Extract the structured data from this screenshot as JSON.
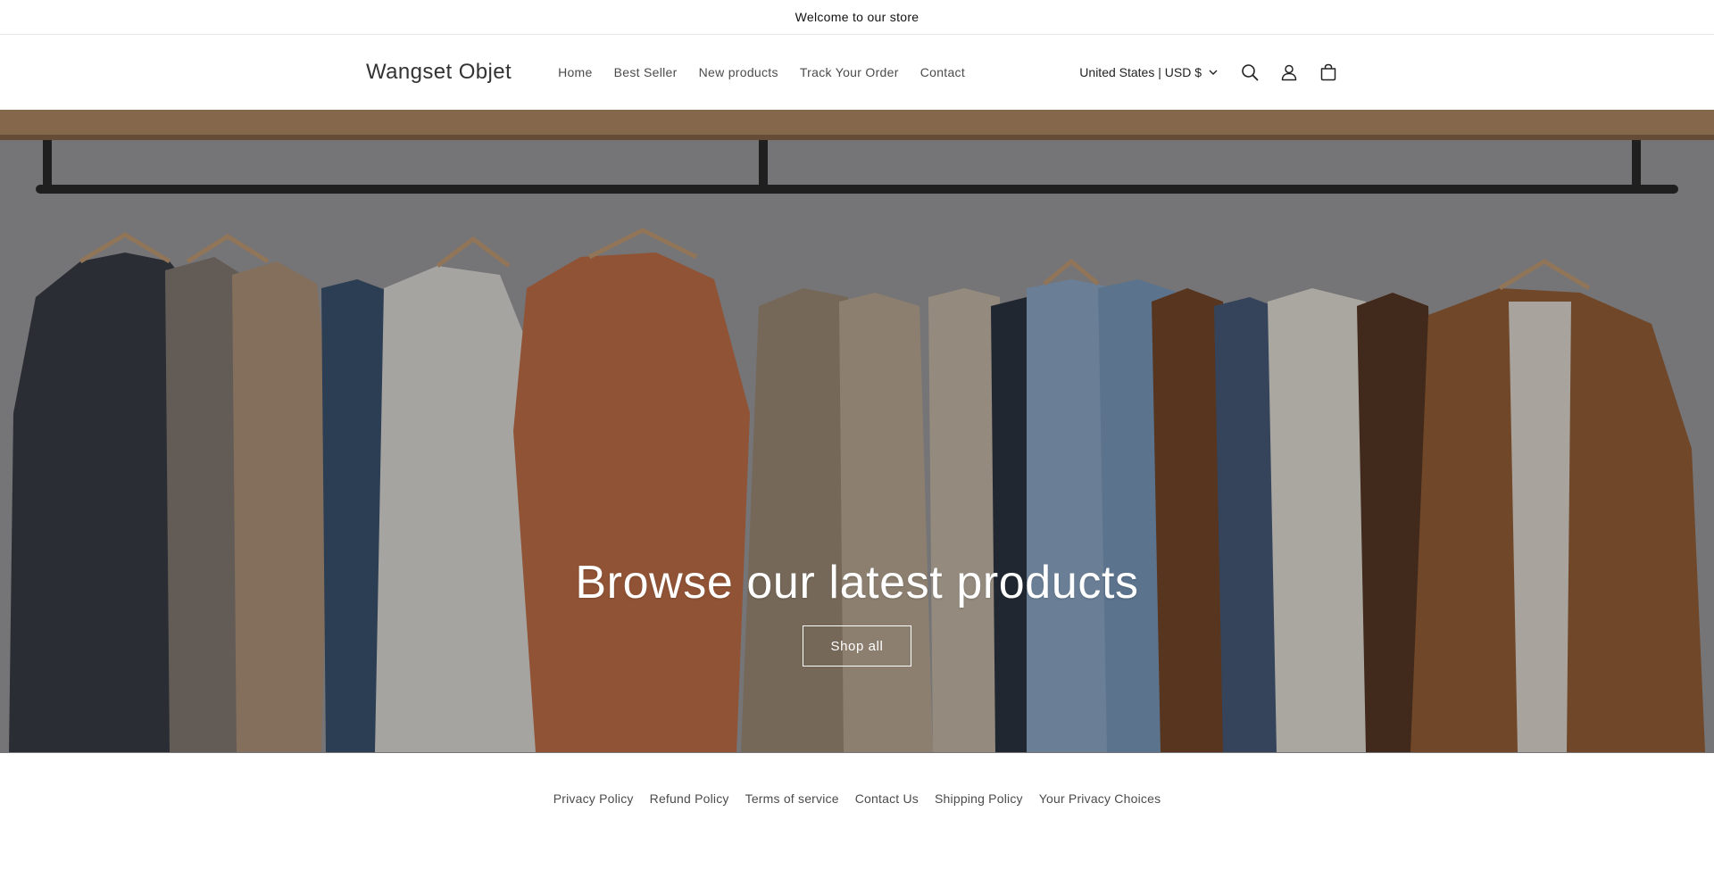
{
  "announcement": {
    "text": "Welcome to our store"
  },
  "header": {
    "logo": "Wangset Objet",
    "nav": [
      {
        "label": "Home"
      },
      {
        "label": "Best Seller"
      },
      {
        "label": "New products"
      },
      {
        "label": "Track Your Order"
      },
      {
        "label": "Contact"
      }
    ],
    "country_selector": {
      "label": "United States | USD $"
    },
    "icons": [
      "search-icon",
      "account-icon",
      "cart-icon"
    ]
  },
  "hero": {
    "title": "Browse our latest products",
    "button_label": "Shop all"
  },
  "footer": {
    "policies": [
      {
        "label": "Privacy Policy"
      },
      {
        "label": "Refund Policy"
      },
      {
        "label": "Terms of service"
      },
      {
        "label": "Contact Us"
      },
      {
        "label": "Shipping Policy"
      },
      {
        "label": "Your Privacy Choices"
      }
    ]
  },
  "colors": {
    "text": "#121212",
    "link": "#4b4b4b",
    "border": "#e8e8e8",
    "hero_text": "#ffffff"
  }
}
